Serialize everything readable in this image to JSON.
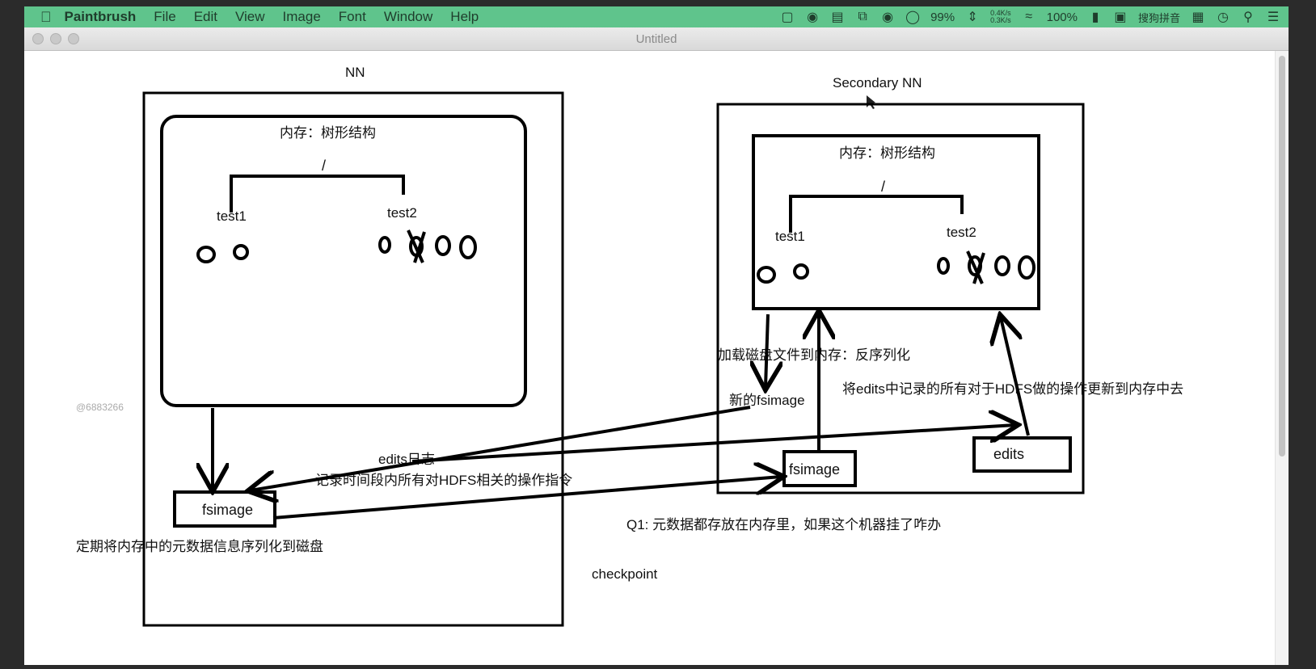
{
  "menubar": {
    "app_name": "Paintbrush",
    "menus": [
      "File",
      "Edit",
      "View",
      "Image",
      "Font",
      "Window",
      "Help"
    ],
    "status": {
      "battery_small": "99%",
      "net_up": "0.4K/s",
      "net_down": "0.3K/s",
      "battery": "100%",
      "input_method": "搜狗拼音"
    }
  },
  "window": {
    "title": "Untitled"
  },
  "drawing": {
    "nn_title": "NN",
    "snn_title": "Secondary NN",
    "memory_label": "内存：树形结构",
    "root_label": "/",
    "test1": "test1",
    "test2": "test2",
    "fsimage": "fsimage",
    "edits": "edits",
    "edits_log": "edits日志",
    "record_text": "记录时间段内所有对HDFS相关的操作指令",
    "serialize_text": "定期将内存中的元数据信息序列化到磁盘",
    "load_text": "加载磁盘文件到内存：反序列化",
    "new_fsimage": "新的fsimage",
    "update_text": "将edits中记录的所有对于HDFS做的操作更新到内存中去",
    "q1_text": "Q1: 元数据都存放在内存里，如果这个机器挂了咋办",
    "checkpoint": "checkpoint",
    "watermark": "@6883266"
  }
}
